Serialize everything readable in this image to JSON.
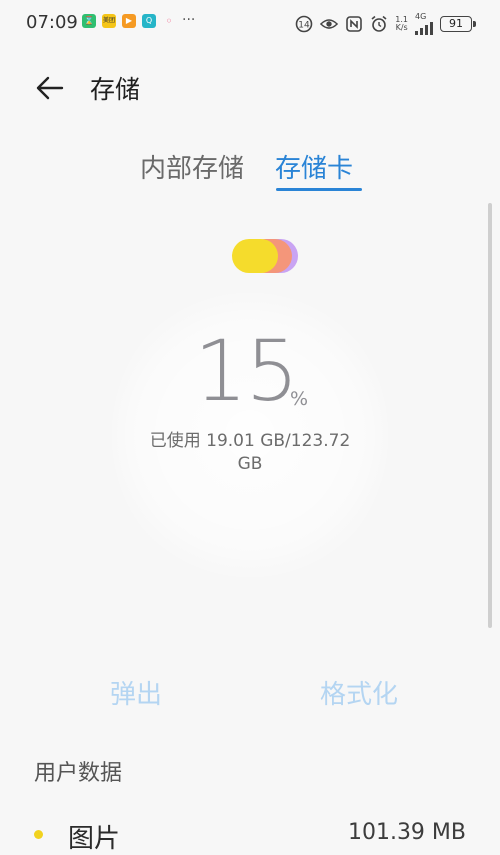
{
  "status_bar": {
    "time": "07:09",
    "app_icons": [
      {
        "name": "hourglass-app-icon",
        "color": "#2fbf71",
        "glyph": "⌛"
      },
      {
        "name": "meituan-app-icon",
        "color": "#f5c518",
        "glyph": "美团"
      },
      {
        "name": "play-app-icon",
        "color": "#f59a23",
        "glyph": "▶"
      },
      {
        "name": "search-app-icon",
        "color": "#26b5c8",
        "glyph": "Q"
      },
      {
        "name": "pink-app-icon",
        "color": "#f06b8d",
        "glyph": "◦"
      }
    ],
    "more": "···",
    "net_speed_value": "1.1",
    "net_speed_unit": "K/s",
    "network_type": "4G",
    "battery": "91"
  },
  "header": {
    "title": "存储"
  },
  "tabs": [
    {
      "label": "内部存储",
      "active": false
    },
    {
      "label": "存储卡",
      "active": true
    }
  ],
  "storage": {
    "percent_used": 15,
    "percent_display": "15",
    "percent_unit": "%",
    "usage_text": "已使用 19.01 GB/123.72 GB"
  },
  "actions": {
    "eject_label": "弹出",
    "format_label": "格式化"
  },
  "section": {
    "title": "用户数据",
    "items": [
      {
        "label": "图片",
        "value": "101.39 MB",
        "dot_color": "#f1d21f"
      }
    ]
  },
  "colors": {
    "accent": "#2a84d6",
    "disabled_action": "#b4d5f2"
  }
}
